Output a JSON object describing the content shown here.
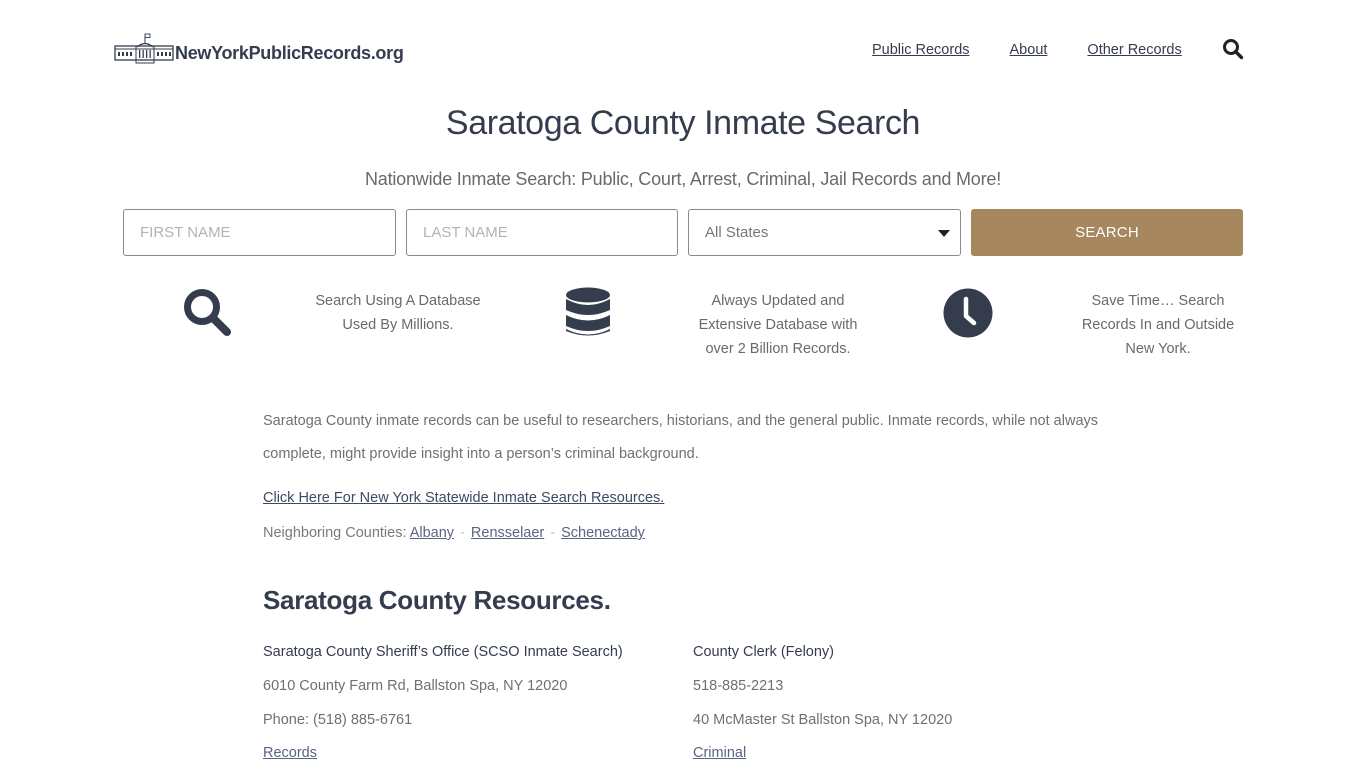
{
  "header": {
    "logo_text": "NewYorkPublicRecords.org",
    "nav": [
      {
        "label": "Public Records"
      },
      {
        "label": "About"
      },
      {
        "label": "Other Records"
      }
    ],
    "search_icon": "search-icon"
  },
  "page": {
    "title": "Saratoga County Inmate Search",
    "subtitle": "Nationwide Inmate Search: Public, Court, Arrest, Criminal, Jail Records and More!"
  },
  "search_form": {
    "first_name_placeholder": "FIRST NAME",
    "last_name_placeholder": "LAST NAME",
    "state_selected": "All States",
    "button_label": "SEARCH",
    "button_color": "#a6875e"
  },
  "features": [
    {
      "icon": "search-icon",
      "text_lines": [
        "Search Using A Database",
        "Used By Millions."
      ]
    },
    {
      "icon": "database-icon",
      "text_lines": [
        "Always Updated and",
        "Extensive Database with",
        "over 2 Billion Records."
      ]
    },
    {
      "icon": "clock-icon",
      "text_lines": [
        "Save Time… Search",
        "Records In and Outside",
        "New York."
      ]
    }
  ],
  "intro": {
    "paragraph_line1": "Saratoga County inmate records can be useful to researchers, historians, and the general public. Inmate records, while not always",
    "paragraph_line2": "complete, might provide insight into a person’s criminal background.",
    "statewide_link": "Click Here For New York Statewide Inmate Search Resources.",
    "neighbors_label": "Neighboring Counties:",
    "neighbors": [
      "Albany",
      "Rensselaer",
      "Schenectady"
    ],
    "separator": "-"
  },
  "resources": {
    "heading": "Saratoga County Resources.",
    "items": [
      {
        "name": "Saratoga County Sheriff’s Office (SCSO Inmate Search)",
        "line1": "6010 County Farm Rd, Ballston Spa, NY 12020",
        "line2": "Phone: (518) 885-6761",
        "link": "Records"
      },
      {
        "name": "County Clerk (Felony)",
        "line1": "518-885-2213",
        "line2": "40 McMaster St Ballston Spa, NY 12020",
        "link": "Criminal"
      }
    ]
  },
  "colors": {
    "text_dark": "#343c4e",
    "text_muted": "#707070",
    "accent": "#a6875e"
  }
}
